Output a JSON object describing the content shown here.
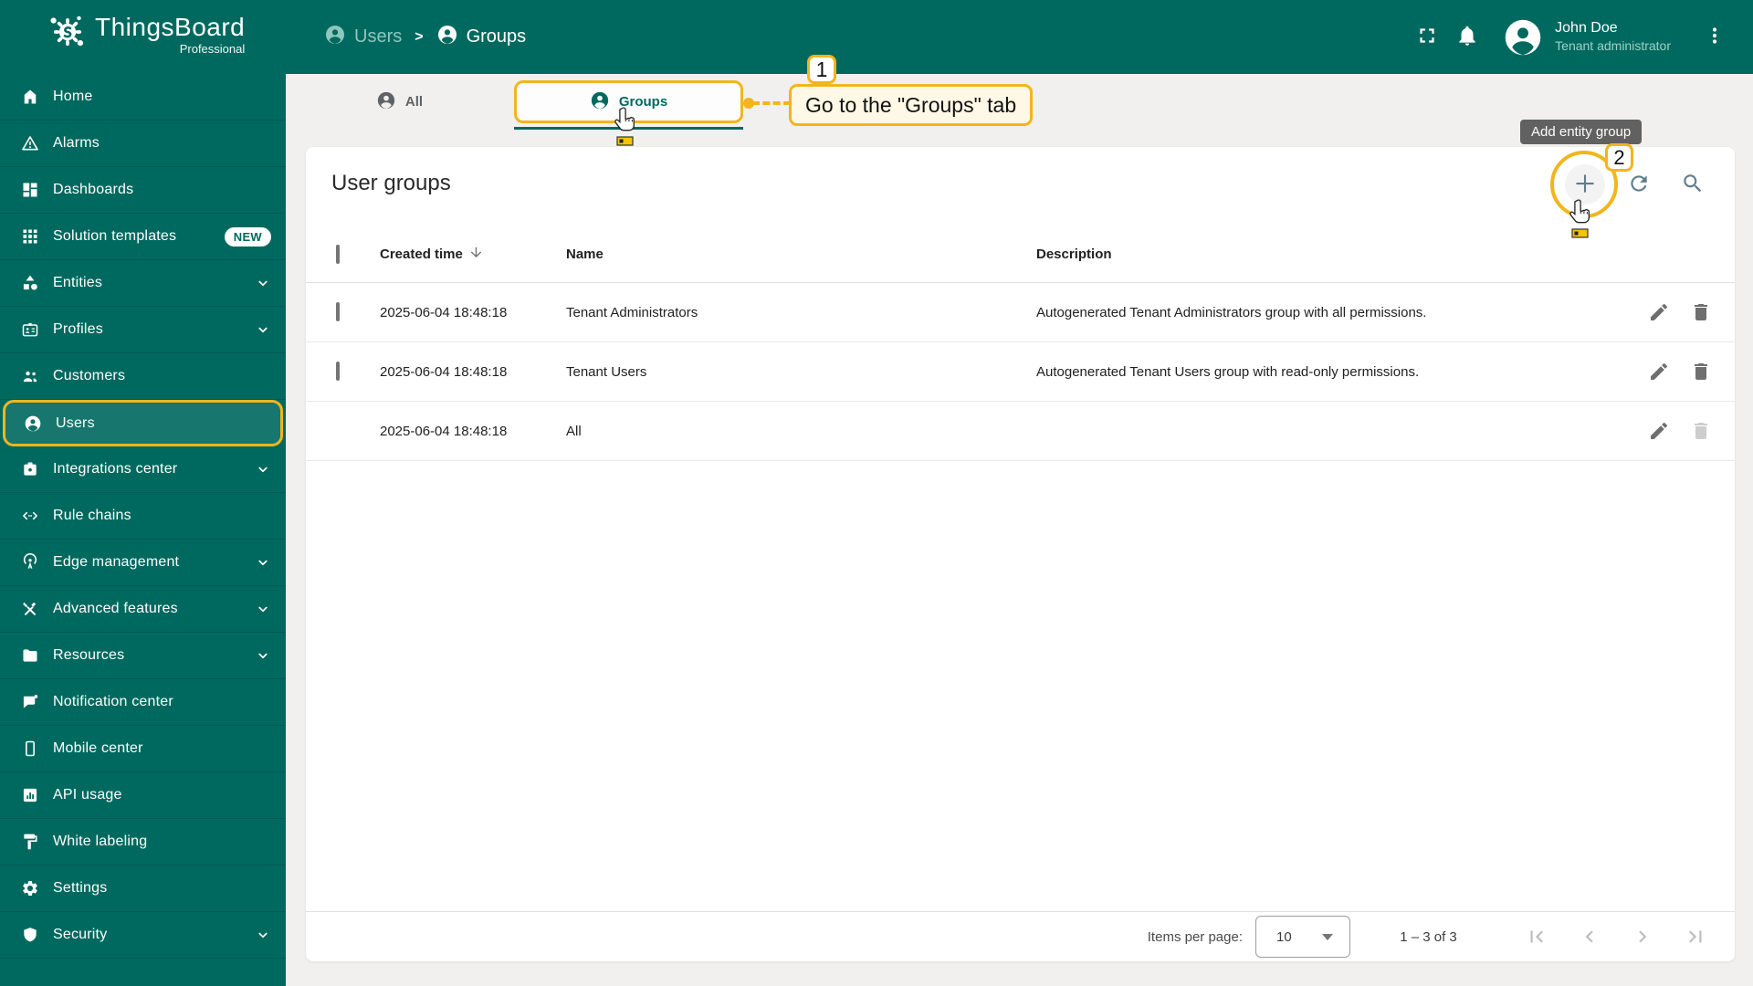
{
  "header": {
    "brand": {
      "name": "ThingsBoard",
      "edition": "Professional"
    },
    "breadcrumb": {
      "separator": ">",
      "items": [
        "Users",
        "Groups"
      ]
    },
    "user": {
      "name": "John Doe",
      "role": "Tenant administrator"
    }
  },
  "sidebar": {
    "items": [
      {
        "label": "Home"
      },
      {
        "label": "Alarms"
      },
      {
        "label": "Dashboards"
      },
      {
        "label": "Solution templates",
        "badge": "NEW"
      },
      {
        "label": "Entities",
        "expandable": true
      },
      {
        "label": "Profiles",
        "expandable": true
      },
      {
        "label": "Customers"
      },
      {
        "label": "Users",
        "active": true
      },
      {
        "label": "Integrations center",
        "expandable": true
      },
      {
        "label": "Rule chains"
      },
      {
        "label": "Edge management",
        "expandable": true
      },
      {
        "label": "Advanced features",
        "expandable": true
      },
      {
        "label": "Resources",
        "expandable": true
      },
      {
        "label": "Notification center"
      },
      {
        "label": "Mobile center"
      },
      {
        "label": "API usage"
      },
      {
        "label": "White labeling"
      },
      {
        "label": "Settings"
      },
      {
        "label": "Security",
        "expandable": true
      }
    ]
  },
  "tabs": {
    "items": [
      {
        "label": "All"
      },
      {
        "label": "Groups",
        "active": true
      }
    ]
  },
  "content": {
    "title": "User groups",
    "toolbar": {
      "add_tooltip": "Add entity group"
    },
    "table": {
      "columns": {
        "created_time": "Created time",
        "name": "Name",
        "description": "Description"
      },
      "rows": [
        {
          "created_time": "2025-06-04 18:48:18",
          "name": "Tenant Administrators",
          "description": "Autogenerated Tenant Administrators group with all permissions."
        },
        {
          "created_time": "2025-06-04 18:48:18",
          "name": "Tenant Users",
          "description": "Autogenerated Tenant Users group with read-only permissions."
        },
        {
          "created_time": "2025-06-04 18:48:18",
          "name": "All",
          "description": ""
        }
      ]
    },
    "pagination": {
      "items_per_page_label": "Items per page:",
      "items_per_page": "10",
      "range": "1 – 3 of 3"
    }
  },
  "annotations": {
    "step1": {
      "number": "1",
      "label": "Go to the \"Groups\" tab"
    },
    "step2": {
      "number": "2"
    }
  },
  "colors": {
    "primary": "#00695f",
    "annotation": "#F2B51D",
    "annotation_bg": "#FFF8E6",
    "tooltip_bg": "#616161",
    "breadcrumb_muted": "#8fc6be"
  }
}
